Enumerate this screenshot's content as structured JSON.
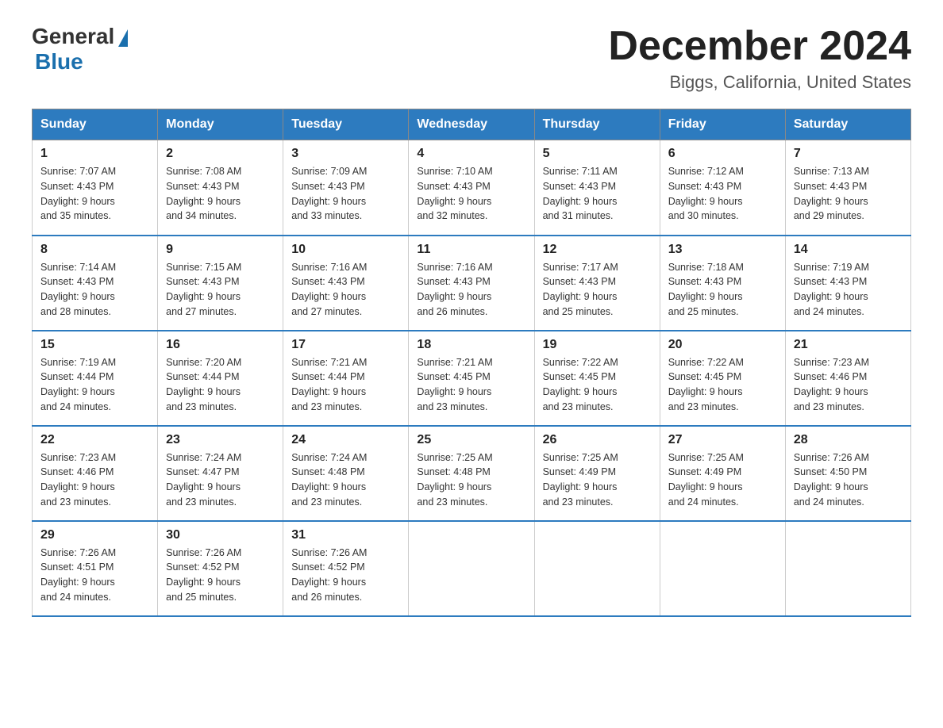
{
  "header": {
    "logo_general": "General",
    "logo_blue": "Blue",
    "month_title": "December 2024",
    "location": "Biggs, California, United States"
  },
  "weekdays": [
    "Sunday",
    "Monday",
    "Tuesday",
    "Wednesday",
    "Thursday",
    "Friday",
    "Saturday"
  ],
  "weeks": [
    [
      {
        "day": "1",
        "sunrise": "7:07 AM",
        "sunset": "4:43 PM",
        "daylight": "9 hours and 35 minutes."
      },
      {
        "day": "2",
        "sunrise": "7:08 AM",
        "sunset": "4:43 PM",
        "daylight": "9 hours and 34 minutes."
      },
      {
        "day": "3",
        "sunrise": "7:09 AM",
        "sunset": "4:43 PM",
        "daylight": "9 hours and 33 minutes."
      },
      {
        "day": "4",
        "sunrise": "7:10 AM",
        "sunset": "4:43 PM",
        "daylight": "9 hours and 32 minutes."
      },
      {
        "day": "5",
        "sunrise": "7:11 AM",
        "sunset": "4:43 PM",
        "daylight": "9 hours and 31 minutes."
      },
      {
        "day": "6",
        "sunrise": "7:12 AM",
        "sunset": "4:43 PM",
        "daylight": "9 hours and 30 minutes."
      },
      {
        "day": "7",
        "sunrise": "7:13 AM",
        "sunset": "4:43 PM",
        "daylight": "9 hours and 29 minutes."
      }
    ],
    [
      {
        "day": "8",
        "sunrise": "7:14 AM",
        "sunset": "4:43 PM",
        "daylight": "9 hours and 28 minutes."
      },
      {
        "day": "9",
        "sunrise": "7:15 AM",
        "sunset": "4:43 PM",
        "daylight": "9 hours and 27 minutes."
      },
      {
        "day": "10",
        "sunrise": "7:16 AM",
        "sunset": "4:43 PM",
        "daylight": "9 hours and 27 minutes."
      },
      {
        "day": "11",
        "sunrise": "7:16 AM",
        "sunset": "4:43 PM",
        "daylight": "9 hours and 26 minutes."
      },
      {
        "day": "12",
        "sunrise": "7:17 AM",
        "sunset": "4:43 PM",
        "daylight": "9 hours and 25 minutes."
      },
      {
        "day": "13",
        "sunrise": "7:18 AM",
        "sunset": "4:43 PM",
        "daylight": "9 hours and 25 minutes."
      },
      {
        "day": "14",
        "sunrise": "7:19 AM",
        "sunset": "4:43 PM",
        "daylight": "9 hours and 24 minutes."
      }
    ],
    [
      {
        "day": "15",
        "sunrise": "7:19 AM",
        "sunset": "4:44 PM",
        "daylight": "9 hours and 24 minutes."
      },
      {
        "day": "16",
        "sunrise": "7:20 AM",
        "sunset": "4:44 PM",
        "daylight": "9 hours and 23 minutes."
      },
      {
        "day": "17",
        "sunrise": "7:21 AM",
        "sunset": "4:44 PM",
        "daylight": "9 hours and 23 minutes."
      },
      {
        "day": "18",
        "sunrise": "7:21 AM",
        "sunset": "4:45 PM",
        "daylight": "9 hours and 23 minutes."
      },
      {
        "day": "19",
        "sunrise": "7:22 AM",
        "sunset": "4:45 PM",
        "daylight": "9 hours and 23 minutes."
      },
      {
        "day": "20",
        "sunrise": "7:22 AM",
        "sunset": "4:45 PM",
        "daylight": "9 hours and 23 minutes."
      },
      {
        "day": "21",
        "sunrise": "7:23 AM",
        "sunset": "4:46 PM",
        "daylight": "9 hours and 23 minutes."
      }
    ],
    [
      {
        "day": "22",
        "sunrise": "7:23 AM",
        "sunset": "4:46 PM",
        "daylight": "9 hours and 23 minutes."
      },
      {
        "day": "23",
        "sunrise": "7:24 AM",
        "sunset": "4:47 PM",
        "daylight": "9 hours and 23 minutes."
      },
      {
        "day": "24",
        "sunrise": "7:24 AM",
        "sunset": "4:48 PM",
        "daylight": "9 hours and 23 minutes."
      },
      {
        "day": "25",
        "sunrise": "7:25 AM",
        "sunset": "4:48 PM",
        "daylight": "9 hours and 23 minutes."
      },
      {
        "day": "26",
        "sunrise": "7:25 AM",
        "sunset": "4:49 PM",
        "daylight": "9 hours and 23 minutes."
      },
      {
        "day": "27",
        "sunrise": "7:25 AM",
        "sunset": "4:49 PM",
        "daylight": "9 hours and 24 minutes."
      },
      {
        "day": "28",
        "sunrise": "7:26 AM",
        "sunset": "4:50 PM",
        "daylight": "9 hours and 24 minutes."
      }
    ],
    [
      {
        "day": "29",
        "sunrise": "7:26 AM",
        "sunset": "4:51 PM",
        "daylight": "9 hours and 24 minutes."
      },
      {
        "day": "30",
        "sunrise": "7:26 AM",
        "sunset": "4:52 PM",
        "daylight": "9 hours and 25 minutes."
      },
      {
        "day": "31",
        "sunrise": "7:26 AM",
        "sunset": "4:52 PM",
        "daylight": "9 hours and 26 minutes."
      },
      null,
      null,
      null,
      null
    ]
  ],
  "labels": {
    "sunrise": "Sunrise: ",
    "sunset": "Sunset: ",
    "daylight": "Daylight: "
  }
}
